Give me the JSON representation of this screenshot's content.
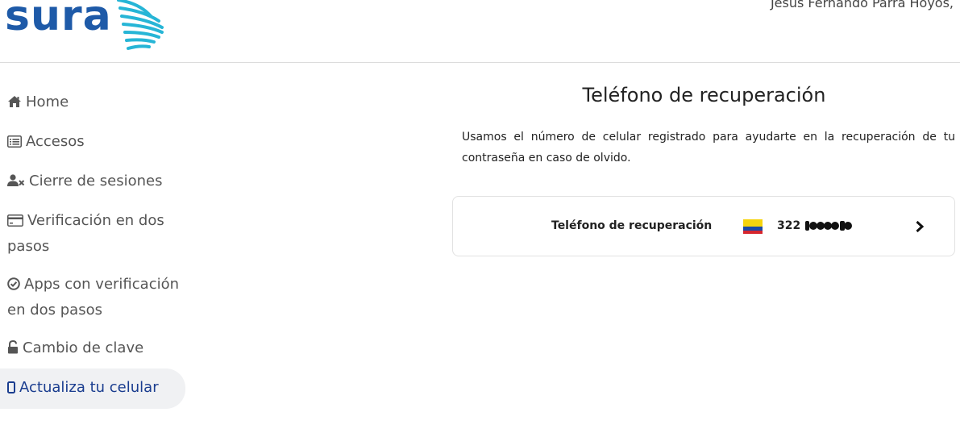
{
  "header": {
    "logo_text": "sura",
    "username": "Jesus Fernando Parra Hoyos,"
  },
  "sidebar": {
    "items": [
      {
        "label": "Home",
        "icon": "home-icon"
      },
      {
        "label": "Accesos",
        "icon": "list-icon"
      },
      {
        "label": "Cierre de sesiones",
        "icon": "user-times-icon"
      },
      {
        "label": "Verificación en dos pasos",
        "icon": "credit-card-icon"
      },
      {
        "label": "Apps con verificación en dos pasos",
        "icon": "check-circle-icon"
      },
      {
        "label": "Cambio de clave",
        "icon": "unlock-icon"
      },
      {
        "label": "Actualiza tu celular",
        "icon": "mobile-icon",
        "active": true
      }
    ]
  },
  "main": {
    "title": "Teléfono de recuperación",
    "description": "Usamos el número de celular registrado para ayudarte en la recuperación de tu contraseña en caso de olvido.",
    "card": {
      "label": "Teléfono de recuperación",
      "phone_prefix": "322",
      "flag": "colombia-flag-icon"
    }
  },
  "colors": {
    "brand_blue": "#1e5aa8",
    "brand_teal": "#26b5d6",
    "active_text": "#1a3d8f",
    "active_bg": "#f0f1f3"
  }
}
